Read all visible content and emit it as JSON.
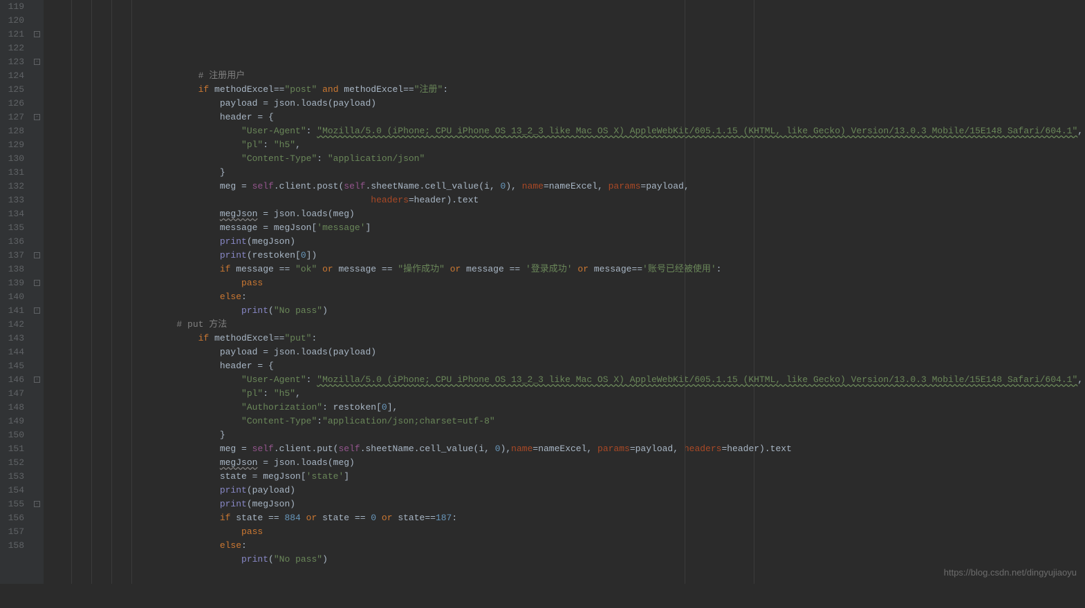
{
  "watermark": "https://blog.csdn.net/dingyujiaoyu",
  "startLine": 119,
  "endLine": 158,
  "rulers": [
    990,
    1090
  ],
  "foldMarks": [
    121,
    123,
    127,
    137,
    139,
    141,
    146,
    155
  ],
  "code": {
    "l119": "",
    "l120": {
      "indent": 12,
      "tokens": [
        [
          "com",
          "# 注册用户"
        ]
      ]
    },
    "l121": {
      "indent": 12,
      "tokens": [
        [
          "kw",
          "if"
        ],
        [
          "op",
          " methodExcel"
        ],
        [
          "op",
          "=="
        ],
        [
          "str",
          "\"post\""
        ],
        [
          "op",
          " "
        ],
        [
          "kw",
          "and"
        ],
        [
          "op",
          " methodExcel"
        ],
        [
          "op",
          "=="
        ],
        [
          "str",
          "\"注册\""
        ],
        [
          "op",
          ":"
        ]
      ]
    },
    "l122": {
      "indent": 16,
      "tokens": [
        [
          "ident",
          "payload = json.loads(payload)"
        ]
      ]
    },
    "l123": {
      "indent": 16,
      "tokens": [
        [
          "ident",
          "header = {"
        ]
      ]
    },
    "l124": {
      "indent": 20,
      "tokens": [
        [
          "str",
          "\"User-Agent\""
        ],
        [
          "op",
          ": "
        ],
        [
          "str-u",
          "\"Mozilla/5.0 (iPhone; CPU iPhone OS 13_2_3 like Mac OS X) AppleWebKit/605.1.15 (KHTML, like Gecko) Version/13.0.3 Mobile/15E148 Safari/604.1\""
        ],
        [
          "op",
          ","
        ]
      ]
    },
    "l125": {
      "indent": 20,
      "tokens": [
        [
          "str",
          "\"pl\""
        ],
        [
          "op",
          ": "
        ],
        [
          "str",
          "\"h5\""
        ],
        [
          "op",
          ","
        ]
      ]
    },
    "l126": {
      "indent": 20,
      "tokens": [
        [
          "str",
          "\"Content-Type\""
        ],
        [
          "op",
          ": "
        ],
        [
          "str",
          "\"application/json\""
        ]
      ]
    },
    "l127": {
      "indent": 16,
      "tokens": [
        [
          "op",
          "}"
        ]
      ]
    },
    "l128": {
      "indent": 16,
      "tokens": [
        [
          "ident",
          "meg = "
        ],
        [
          "self",
          "self"
        ],
        [
          "ident",
          ".client.post("
        ],
        [
          "self",
          "self"
        ],
        [
          "ident",
          ".sheetName.cell_value(i"
        ],
        [
          "op",
          ", "
        ],
        [
          "num",
          "0"
        ],
        [
          "op",
          "), "
        ],
        [
          "param",
          "name"
        ],
        [
          "op",
          "=nameExcel, "
        ],
        [
          "param",
          "params"
        ],
        [
          "op",
          "=payload,"
        ]
      ]
    },
    "l129": {
      "indent": 44,
      "tokens": [
        [
          "param",
          "headers"
        ],
        [
          "op",
          "=header).text"
        ]
      ]
    },
    "l130": {
      "indent": 16,
      "tokens": [
        [
          "ident-u",
          "megJson"
        ],
        [
          "ident",
          " = json.loads(meg)"
        ]
      ]
    },
    "l131": {
      "indent": 16,
      "tokens": [
        [
          "ident",
          "message = megJson["
        ],
        [
          "str",
          "'message'"
        ],
        [
          "ident",
          "]"
        ]
      ]
    },
    "l132": {
      "indent": 16,
      "tokens": [
        [
          "builtin",
          "print"
        ],
        [
          "ident",
          "(megJson)"
        ]
      ]
    },
    "l133": {
      "indent": 16,
      "tokens": [
        [
          "builtin",
          "print"
        ],
        [
          "ident",
          "(restoken["
        ],
        [
          "num",
          "0"
        ],
        [
          "ident",
          "])"
        ]
      ]
    },
    "l134": {
      "indent": 16,
      "tokens": [
        [
          "kw",
          "if"
        ],
        [
          "ident",
          " message == "
        ],
        [
          "str",
          "\"ok\""
        ],
        [
          "ident",
          " "
        ],
        [
          "kw",
          "or"
        ],
        [
          "ident",
          " message == "
        ],
        [
          "str",
          "\"操作成功\""
        ],
        [
          "ident",
          " "
        ],
        [
          "kw",
          "or"
        ],
        [
          "ident",
          " message == "
        ],
        [
          "str",
          "'登录成功'"
        ],
        [
          "ident",
          " "
        ],
        [
          "kw",
          "or"
        ],
        [
          "ident",
          " message"
        ],
        [
          "op",
          "=="
        ],
        [
          "str",
          "'账号已经被使用'"
        ],
        [
          "ident",
          ":"
        ]
      ]
    },
    "l135": {
      "indent": 20,
      "tokens": [
        [
          "kw",
          "pass"
        ]
      ]
    },
    "l136": {
      "indent": 16,
      "tokens": [
        [
          "kw",
          "else"
        ],
        [
          "op",
          ":"
        ]
      ]
    },
    "l137": {
      "indent": 20,
      "tokens": [
        [
          "builtin",
          "print"
        ],
        [
          "ident",
          "("
        ],
        [
          "str",
          "\"No pass\""
        ],
        [
          "ident",
          ")"
        ]
      ]
    },
    "l138": {
      "indent": 8,
      "tokens": [
        [
          "com",
          "# put 方法"
        ]
      ]
    },
    "l139": {
      "indent": 12,
      "tokens": [
        [
          "kw",
          "if"
        ],
        [
          "ident",
          " methodExcel"
        ],
        [
          "op",
          "=="
        ],
        [
          "str",
          "\"put\""
        ],
        [
          "op",
          ":"
        ]
      ]
    },
    "l140": {
      "indent": 16,
      "tokens": [
        [
          "ident",
          "payload = json.loads(payload)"
        ]
      ]
    },
    "l141": {
      "indent": 16,
      "tokens": [
        [
          "ident",
          "header = {"
        ]
      ]
    },
    "l142": {
      "indent": 20,
      "tokens": [
        [
          "str",
          "\"User-Agent\""
        ],
        [
          "op",
          ": "
        ],
        [
          "str-u",
          "\"Mozilla/5.0 (iPhone; CPU iPhone OS 13_2_3 like Mac OS X) AppleWebKit/605.1.15 (KHTML, like Gecko) Version/13.0.3 Mobile/15E148 Safari/604.1\""
        ],
        [
          "op",
          ","
        ]
      ]
    },
    "l143": {
      "indent": 20,
      "tokens": [
        [
          "str",
          "\"pl\""
        ],
        [
          "op",
          ": "
        ],
        [
          "str",
          "\"h5\""
        ],
        [
          "op",
          ","
        ]
      ]
    },
    "l144": {
      "indent": 20,
      "tokens": [
        [
          "str",
          "\"Authorization\""
        ],
        [
          "op",
          ": restoken["
        ],
        [
          "num",
          "0"
        ],
        [
          "op",
          "],"
        ]
      ]
    },
    "l145": {
      "indent": 20,
      "tokens": [
        [
          "str",
          "\"Content-Type\""
        ],
        [
          "op",
          ":"
        ],
        [
          "str",
          "\"application/json;charset=utf-8\""
        ]
      ]
    },
    "l146": {
      "indent": 16,
      "tokens": [
        [
          "op",
          "}"
        ]
      ]
    },
    "l147": {
      "indent": 16,
      "tokens": [
        [
          "ident",
          "meg = "
        ],
        [
          "self",
          "self"
        ],
        [
          "ident",
          ".client.put("
        ],
        [
          "self",
          "self"
        ],
        [
          "ident",
          ".sheetName.cell_value(i"
        ],
        [
          "op",
          ", "
        ],
        [
          "num",
          "0"
        ],
        [
          "ident",
          "),"
        ],
        [
          "param",
          "name"
        ],
        [
          "ident",
          "=nameExcel, "
        ],
        [
          "param",
          "params"
        ],
        [
          "ident",
          "=payload, "
        ],
        [
          "param",
          "headers"
        ],
        [
          "ident",
          "=header).text"
        ]
      ]
    },
    "l148": {
      "indent": 16,
      "tokens": [
        [
          "ident-u",
          "megJson"
        ],
        [
          "ident",
          " = json.loads(meg)"
        ]
      ]
    },
    "l149": {
      "indent": 16,
      "tokens": [
        [
          "ident",
          "state = megJson["
        ],
        [
          "str",
          "'state'"
        ],
        [
          "ident",
          "]"
        ]
      ]
    },
    "l150": {
      "indent": 16,
      "tokens": [
        [
          "builtin",
          "print"
        ],
        [
          "ident",
          "(payload)"
        ]
      ]
    },
    "l151": {
      "indent": 16,
      "tokens": [
        [
          "builtin",
          "print"
        ],
        [
          "ident",
          "(megJson)"
        ]
      ]
    },
    "l152": {
      "indent": 16,
      "tokens": [
        [
          "kw",
          "if"
        ],
        [
          "ident",
          " state == "
        ],
        [
          "num",
          "884"
        ],
        [
          "ident",
          " "
        ],
        [
          "kw",
          "or"
        ],
        [
          "ident",
          " state == "
        ],
        [
          "num",
          "0"
        ],
        [
          "ident",
          " "
        ],
        [
          "kw",
          "or"
        ],
        [
          "ident",
          " state"
        ],
        [
          "op",
          "=="
        ],
        [
          "num",
          "187"
        ],
        [
          "ident",
          ":"
        ]
      ]
    },
    "l153": {
      "indent": 20,
      "tokens": [
        [
          "kw",
          "pass"
        ]
      ]
    },
    "l154": {
      "indent": 16,
      "tokens": [
        [
          "kw",
          "else"
        ],
        [
          "op",
          ":"
        ]
      ]
    },
    "l155": {
      "indent": 20,
      "tokens": [
        [
          "builtin",
          "print"
        ],
        [
          "ident",
          "("
        ],
        [
          "str",
          "\"No pass\""
        ],
        [
          "ident",
          ")"
        ]
      ]
    },
    "l156": "",
    "l157": "",
    "l158": ""
  }
}
